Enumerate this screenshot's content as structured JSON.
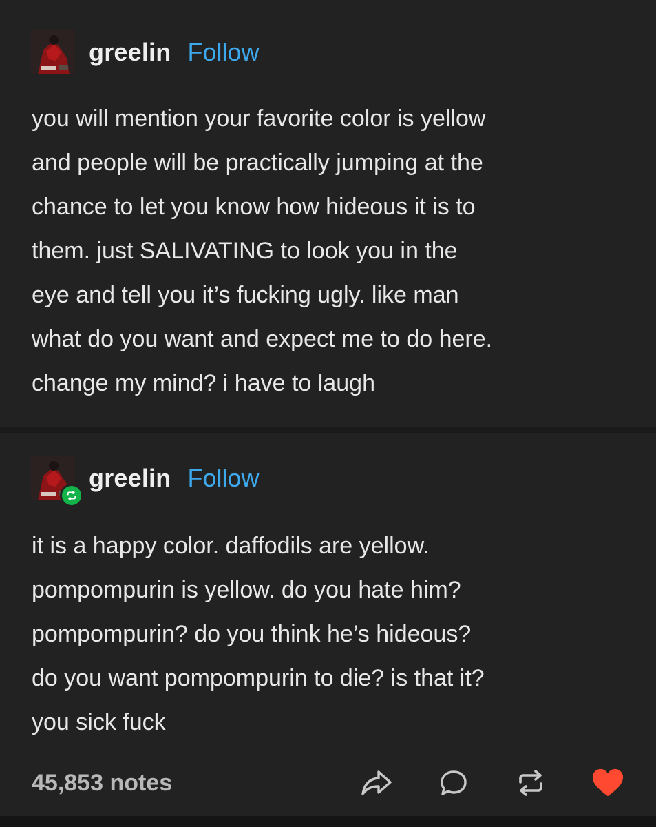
{
  "post_original": {
    "username": "greelin",
    "follow_label": "Follow",
    "avatar_icon": "user-avatar",
    "lines": [
      "you will mention your favorite color is yellow",
      "and people will be practically jumping at the",
      "chance to let you know how hideous it is to",
      "them. just SALIVATING to look you in the",
      "eye and tell you it’s fucking ugly. like man",
      "what do you want and expect me to do here.",
      "change my mind? i have to laugh"
    ]
  },
  "post_reblog": {
    "username": "greelin",
    "follow_label": "Follow",
    "avatar_icon": "user-avatar",
    "badge_icon": "reblog-badge-icon",
    "lines": [
      "it is a happy color. daffodils are yellow.",
      "pompompurin is yellow. do you hate him?",
      "pompompurin? do you think he’s hideous?",
      "do you want pompompurin to die? is that it?",
      "you sick fuck"
    ]
  },
  "footer": {
    "notes": "45,853 notes",
    "actions": [
      {
        "name": "share",
        "icon": "share-arrow-icon"
      },
      {
        "name": "reply",
        "icon": "speech-bubble-icon"
      },
      {
        "name": "reblog",
        "icon": "reblog-icon"
      },
      {
        "name": "like",
        "icon": "heart-icon"
      }
    ]
  },
  "colors": {
    "background": "#222222",
    "text": "#e8e8e8",
    "follow": "#3ea8ec",
    "reblog_badge": "#13b34a",
    "heart": "#ff4930",
    "muted": "#b8b8b8"
  }
}
